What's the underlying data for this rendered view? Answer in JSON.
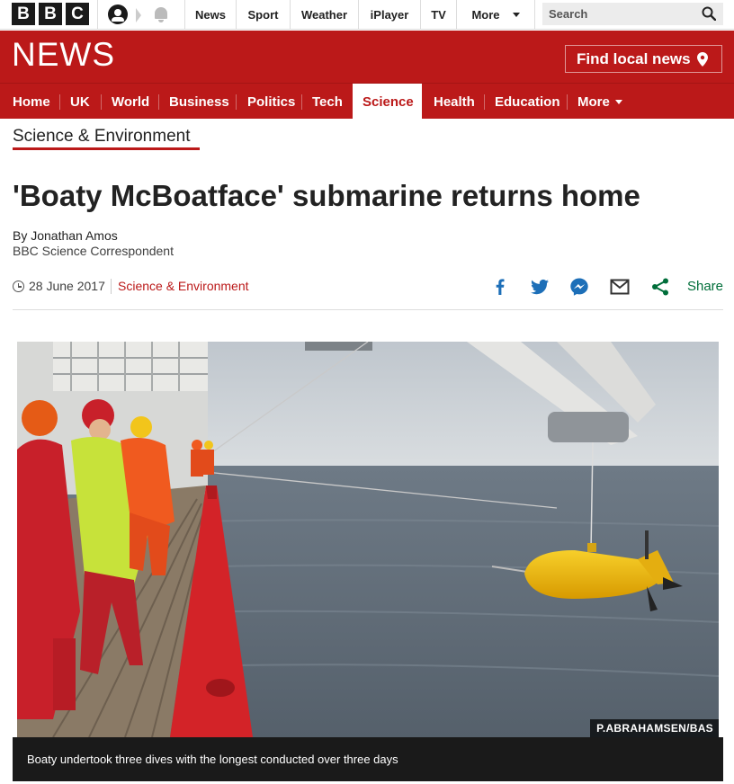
{
  "brand": {
    "logo_letters": [
      "B",
      "B",
      "C"
    ],
    "section_name": "NEWS"
  },
  "topnav": {
    "items": [
      "News",
      "Sport",
      "Weather",
      "iPlayer",
      "TV",
      "More"
    ]
  },
  "search": {
    "placeholder": "Search"
  },
  "find_local": {
    "label": "Find local news"
  },
  "secnav": {
    "items": [
      "Home",
      "UK",
      "World",
      "Business",
      "Politics",
      "Tech",
      "Science",
      "Health",
      "Education",
      "More"
    ],
    "active": "Science"
  },
  "section": {
    "title": "Science & Environment"
  },
  "article": {
    "headline": "'Boaty McBoatface' submarine returns home",
    "byline": "By Jonathan Amos",
    "byline_role": "BBC Science Correspondent",
    "date": "28 June 2017",
    "section_link": "Science & Environment",
    "share_label": "Share",
    "photo_credit": "P.ABRAHAMSEN/BAS",
    "caption": "Boaty undertook three dives with the longest conducted over three days"
  },
  "colors": {
    "brand_red": "#bb1919",
    "share_green": "#006e3a",
    "social_blue": "#1d6fb8"
  },
  "icons": [
    "account-icon",
    "notification-bell-icon",
    "search-icon",
    "location-pin-icon",
    "clock-icon",
    "facebook-icon",
    "twitter-icon",
    "messenger-icon",
    "email-icon",
    "share-icon"
  ]
}
